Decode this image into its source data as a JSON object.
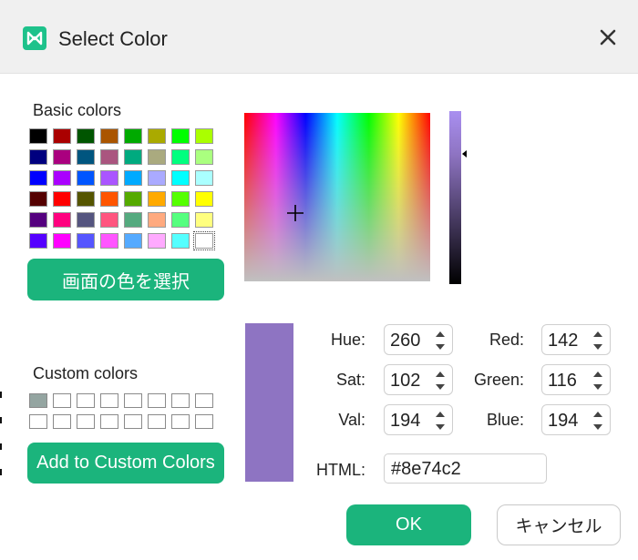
{
  "window": {
    "title": "Select Color",
    "close_icon": "close-icon",
    "app_icon": "mindmaster-logo-icon"
  },
  "basic_colors": {
    "label": "Basic colors",
    "swatches": [
      "#000000",
      "#aa0000",
      "#005500",
      "#aa5500",
      "#00aa00",
      "#aaaa00",
      "#00ff00",
      "#aaff00",
      "#00007f",
      "#aa007f",
      "#00557f",
      "#aa557f",
      "#00aa7f",
      "#aaaa7f",
      "#00ff7f",
      "#aaff7f",
      "#0000ff",
      "#aa00ff",
      "#0055ff",
      "#aa55ff",
      "#00aaff",
      "#aaaaff",
      "#00ffff",
      "#aaffff",
      "#550000",
      "#ff0000",
      "#555500",
      "#ff5500",
      "#55aa00",
      "#ffaa00",
      "#55ff00",
      "#ffff00",
      "#55007f",
      "#ff007f",
      "#55557f",
      "#ff557f",
      "#55aa7f",
      "#ffaa7f",
      "#55ff7f",
      "#ffff7f",
      "#5500ff",
      "#ff00ff",
      "#5555ff",
      "#ff55ff",
      "#55aaff",
      "#ffaaff",
      "#55ffff",
      "#ffffff"
    ],
    "selected_index": 47
  },
  "pick_screen_button": "画面の色を選択",
  "custom_colors": {
    "label": "Custom colors",
    "swatches": [
      "#94a5a1",
      "#ffffff",
      "#ffffff",
      "#ffffff",
      "#ffffff",
      "#ffffff",
      "#ffffff",
      "#ffffff",
      "#ffffff",
      "#ffffff",
      "#ffffff",
      "#ffffff",
      "#ffffff",
      "#ffffff",
      "#ffffff",
      "#ffffff"
    ]
  },
  "add_custom_button": "Add to Custom Colors",
  "current_color": "#8e74c2",
  "fields": {
    "hue": {
      "label": "Hue:",
      "value": "260"
    },
    "sat": {
      "label": "Sat:",
      "value": "102"
    },
    "val": {
      "label": "Val:",
      "value": "194"
    },
    "red": {
      "label": "Red:",
      "value": "142"
    },
    "green": {
      "label": "Green:",
      "value": "116"
    },
    "blue": {
      "label": "Blue:",
      "value": "194"
    },
    "html": {
      "label": "HTML:",
      "value": "#8e74c2"
    }
  },
  "buttons": {
    "ok": "OK",
    "cancel": "キャンセル"
  },
  "colors": {
    "accent": "#1bb47c"
  }
}
